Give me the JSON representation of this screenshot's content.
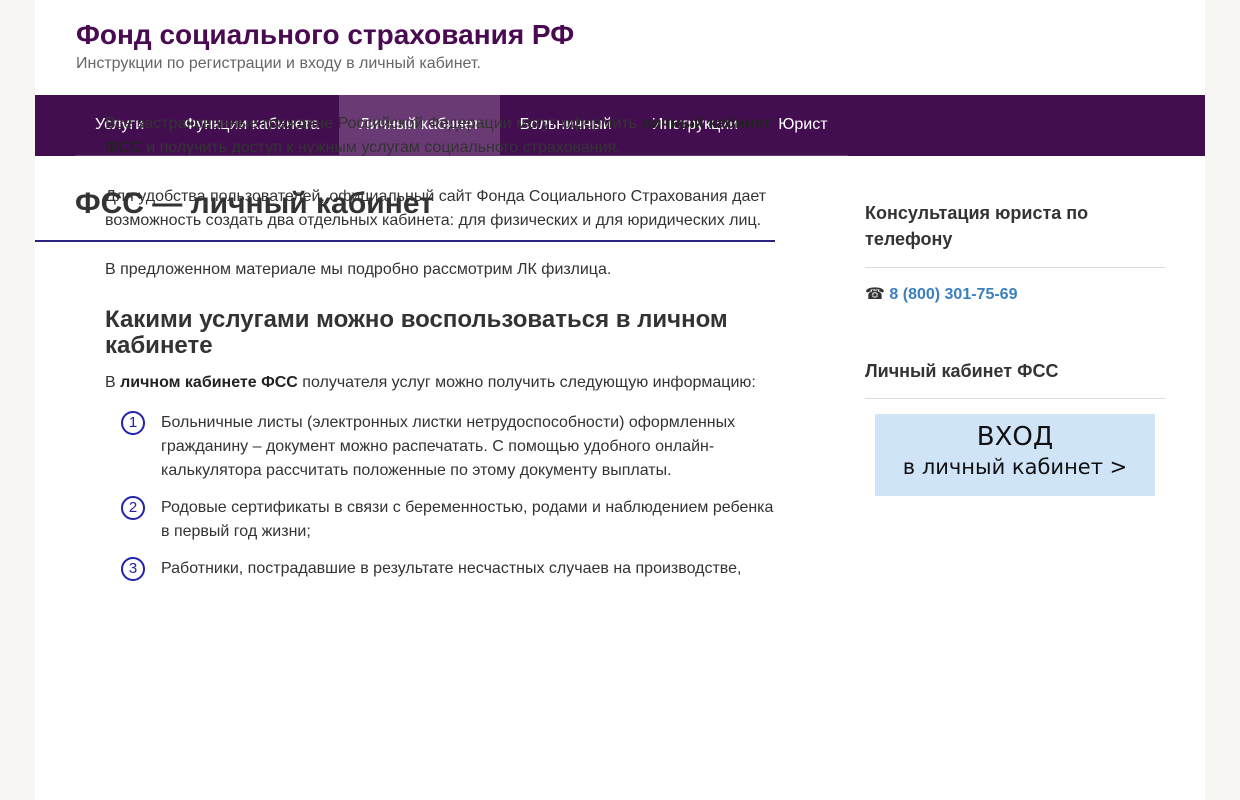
{
  "site": {
    "title": "Фонд социального страхования РФ",
    "description": "Инструкции по регистрации и входу в личный кабинет."
  },
  "nav": {
    "items": [
      {
        "label": "Услуги"
      },
      {
        "label": "Функции кабинета"
      },
      {
        "label": "Личный кабинет",
        "active": true
      },
      {
        "label": "Больничный"
      },
      {
        "label": "Инструкции"
      },
      {
        "label": "Юрист"
      }
    ]
  },
  "article": {
    "title": "ФСС — личный кабинет",
    "p1": {
      "pre": "Все застрахованные граждане Российской Федерации могут оформить ",
      "bold": "личный кабинет ФСС",
      "post": " и получить доступ к нужным услугам социального страхования."
    },
    "p2": "Для удобства пользователей, официальный сайт Фонда Социального Страхования дает возможность  создать два отдельных кабинета: для физических и для юридических лиц.",
    "p3": "В предложенном материале мы подробно рассмотрим ЛК физлица.",
    "h2": "Какими услугами можно воспользоваться в личном кабинете",
    "p4": {
      "pre": "В ",
      "bold": "личном кабинете ФСС",
      "post": " получателя услуг можно получить следующую информацию:"
    },
    "list": [
      {
        "num": "1",
        "text": "Больничные листы (электронных листки нетрудоспособности) оформленных гражданину – документ можно распечатать. С помощью удобного онлайн-калькулятора рассчитать положенные по этому документу выплаты."
      },
      {
        "num": "2",
        "text": "Родовые сертификаты в связи с беременностью, родами и наблюдением ребенка в первый год жизни;"
      },
      {
        "num": "3",
        "text": "Работники, пострадавшие в результате несчастных случаев на производстве,"
      }
    ]
  },
  "sidebar": {
    "consult_title": "Консультация юриста по телефону",
    "phone_icon": "☎",
    "phone": "8 (800) 301-75-69",
    "cabinet_title": "Личный кабинет ФСС",
    "banner_line1": "ВХОД",
    "banner_line2": "в личный кабинет >"
  },
  "colors": {
    "brand": "#4a0a52",
    "nav_bg": "#430e4f",
    "nav_active": "#6a3a74",
    "link": "#3a7fc0",
    "banner_bg": "#cfe4f6"
  }
}
